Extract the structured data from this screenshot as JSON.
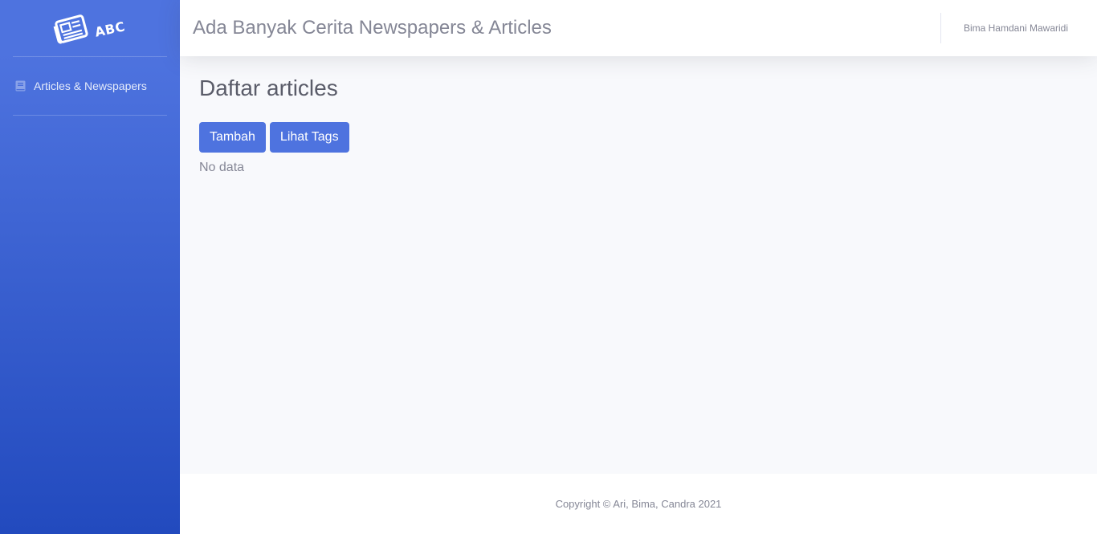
{
  "sidebar": {
    "brand": {
      "logo_icon": "newspaper-icon",
      "text": "ABC"
    },
    "items": [
      {
        "label": "Articles & Newspapers",
        "icon": "book-icon"
      }
    ]
  },
  "topbar": {
    "title": "Ada Banyak Cerita Newspapers & Articles",
    "user_name": "Bima Hamdani Mawaridi"
  },
  "main": {
    "page_title": "Daftar articles",
    "buttons": {
      "add": "Tambah",
      "view_tags": "Lihat Tags"
    },
    "empty_message": "No data"
  },
  "footer": {
    "copyright": "Copyright © Ari, Bima, Candra 2021"
  },
  "colors": {
    "primary": "#4e73df",
    "sidebar_gradient_end": "#224abe",
    "page_background": "#f8f9fc",
    "text_muted": "#858796"
  }
}
